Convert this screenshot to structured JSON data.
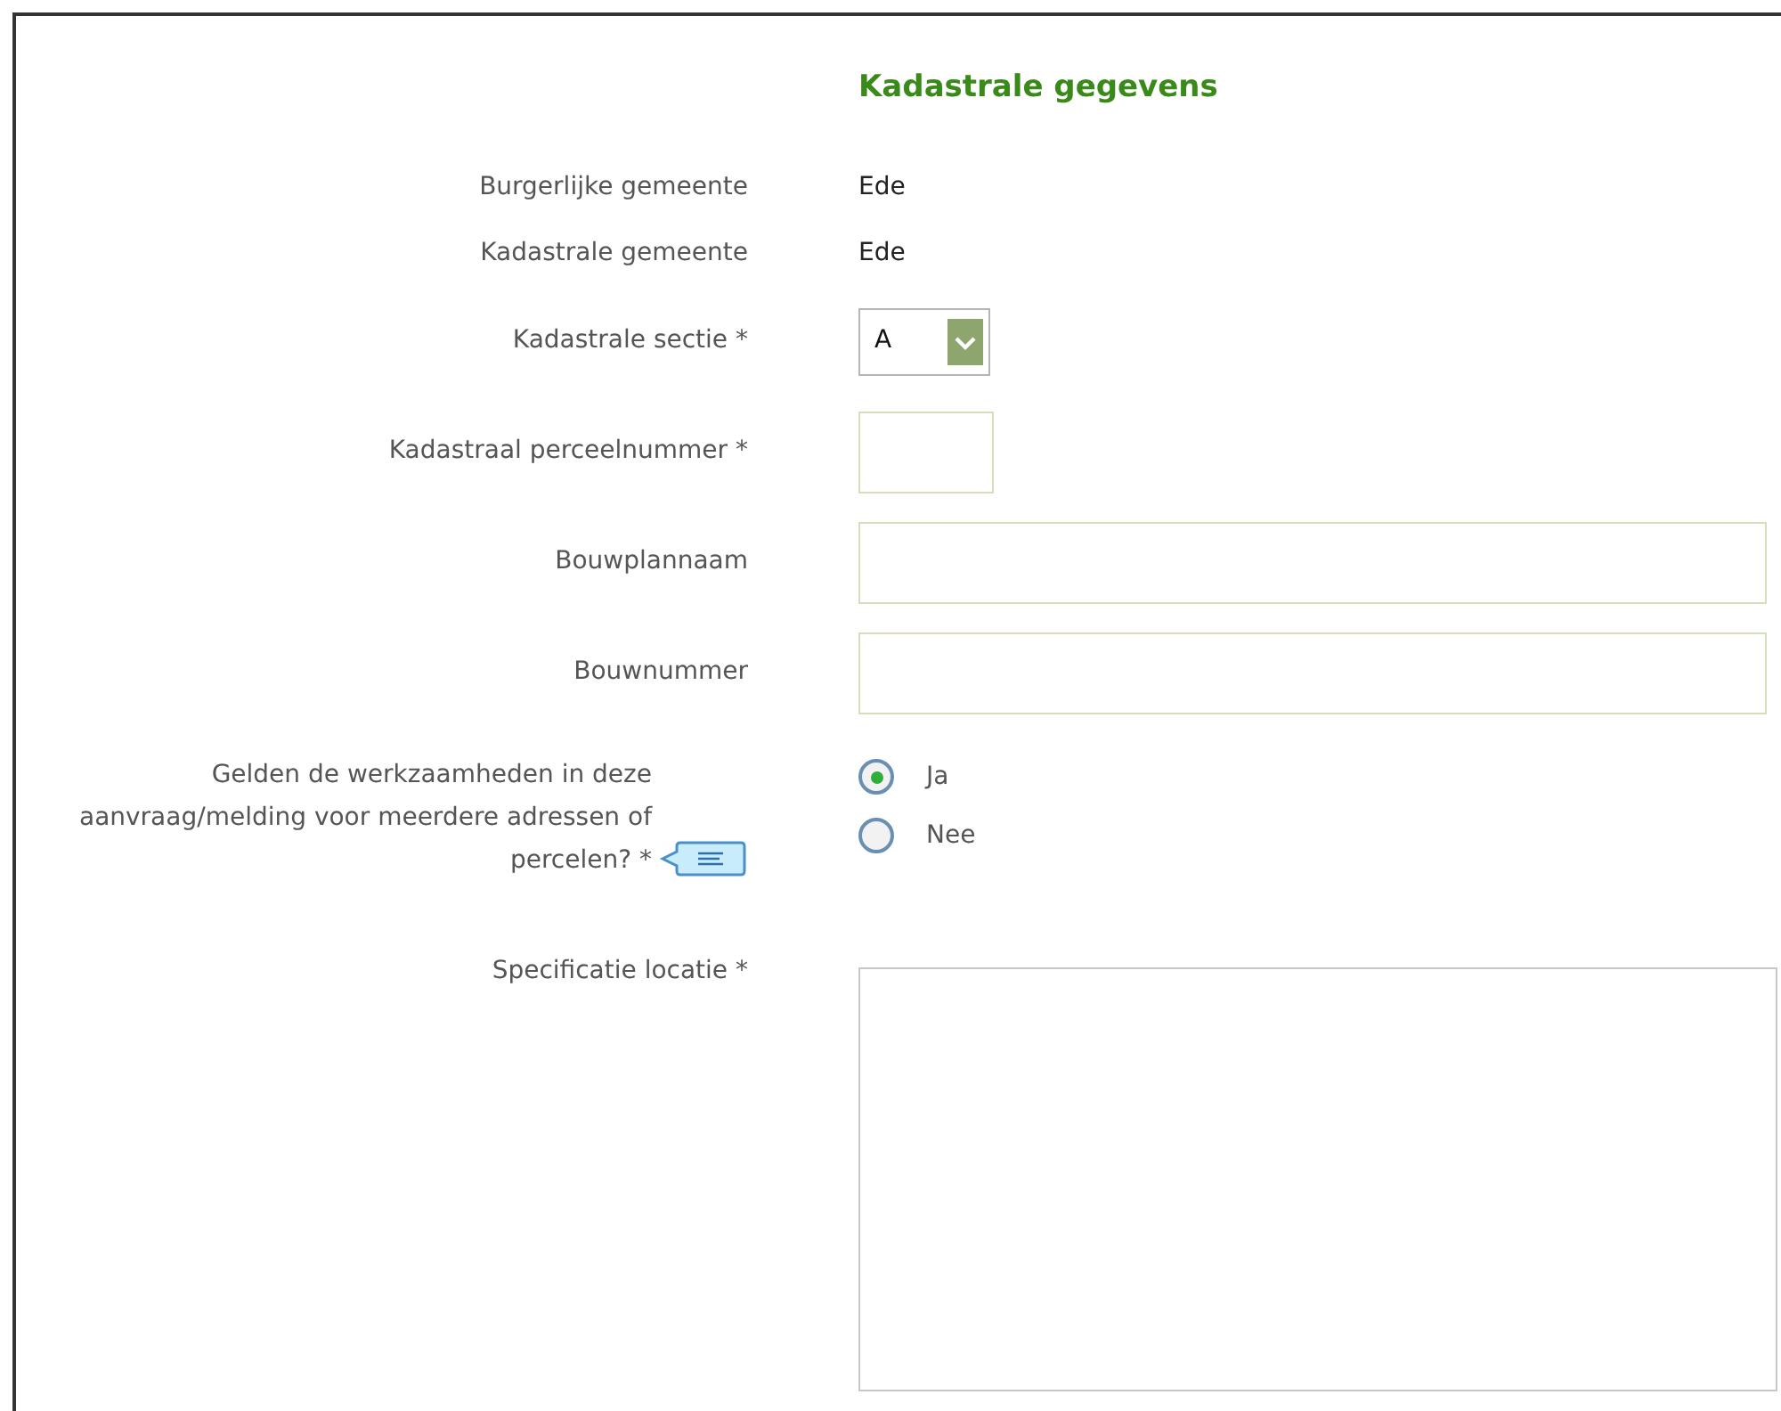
{
  "section": {
    "title": "Kadastrale gegevens"
  },
  "fields": [
    {
      "kind": "static",
      "label": "Burgerlijke gemeente",
      "value": "Ede"
    },
    {
      "kind": "static",
      "label": "Kadastrale gemeente",
      "value": "Ede"
    },
    {
      "kind": "select",
      "label": "Kadastrale sectie *",
      "value": "A"
    },
    {
      "kind": "short",
      "label": "Kadastraal perceelnummer *"
    },
    {
      "kind": "text",
      "label": "Bouwplannaam"
    },
    {
      "kind": "text",
      "label": "Bouwnummer"
    },
    {
      "kind": "radio",
      "label": "Gelden de werkzaamheden in deze aanvraag/melding voor meerdere adressen of percelen? *",
      "help": true,
      "options": [
        {
          "label": "Ja",
          "selected": true
        },
        {
          "label": "Nee",
          "selected": false
        }
      ]
    },
    {
      "kind": "textarea",
      "label": "Specificatie locatie *"
    }
  ]
}
